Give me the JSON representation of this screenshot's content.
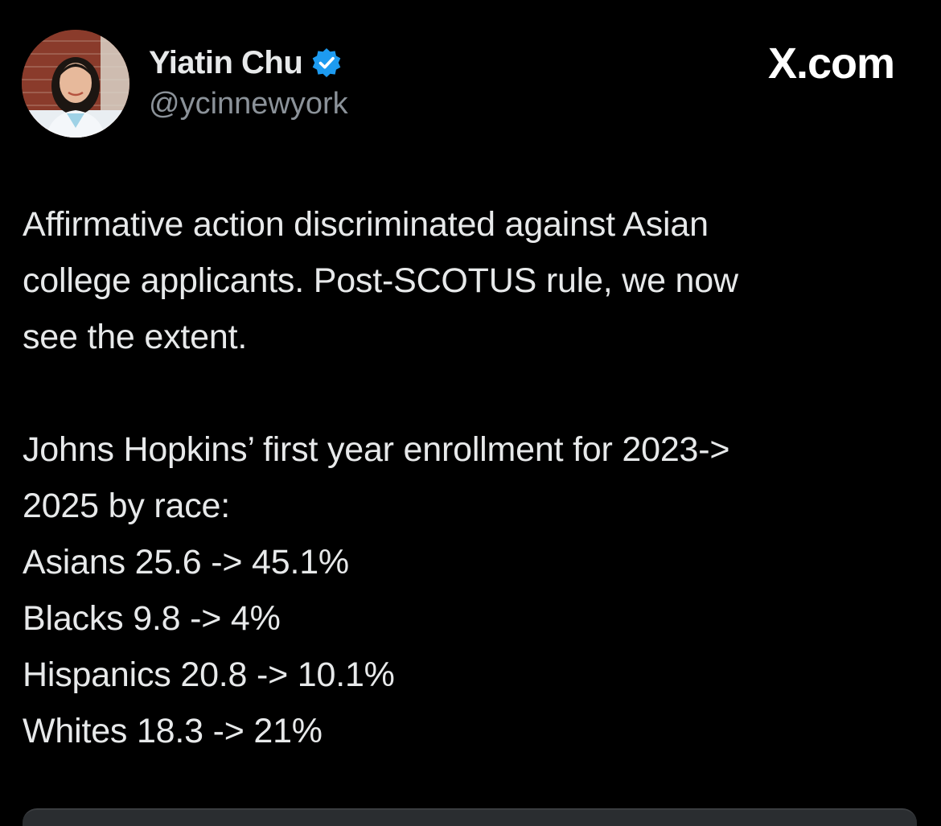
{
  "author": {
    "display_name": "Yiatin Chu",
    "handle": "@ycinnewyork",
    "verified": true,
    "avatar_icon": "avatar-photo"
  },
  "watermark": "X.com",
  "tweet": {
    "lines_paragraph1": [
      "Affirmative action discriminated against Asian",
      "college applicants. Post-SCOTUS rule, we now",
      "see the extent."
    ],
    "lines_paragraph2": [
      "Johns Hopkins’ first year enrollment for 2023->",
      "2025 by race:",
      "Asians 25.6 -> 45.1%",
      "Blacks 9.8 -> 4%",
      "Hispanics 20.8 -> 10.1%",
      "Whites 18.3 -> 21%"
    ]
  },
  "colors": {
    "background": "#000000",
    "text": "#e7e9ea",
    "secondary_text": "#8b9299",
    "verified_badge": "#1d9bf0"
  }
}
